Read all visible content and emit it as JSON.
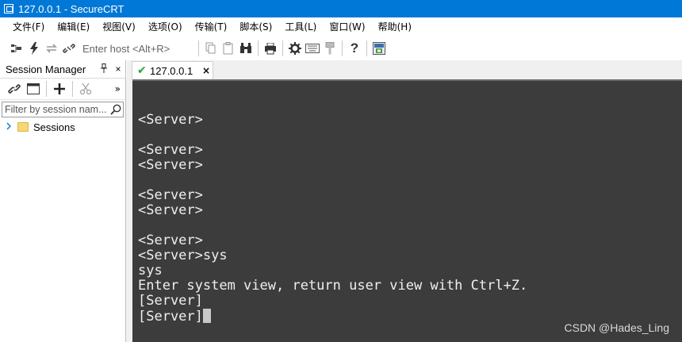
{
  "window": {
    "title": "127.0.0.1 - SecureCRT"
  },
  "menu": [
    "文件(F)",
    "编辑(E)",
    "视图(V)",
    "选项(O)",
    "传输(T)",
    "脚本(S)",
    "工具(L)",
    "窗口(W)",
    "帮助(H)"
  ],
  "toolbar": {
    "host_placeholder": "Enter host <Alt+R>"
  },
  "session_manager": {
    "title": "Session Manager",
    "pin_glyph": "ᵖ",
    "close_glyph": "×",
    "more_glyph": "»",
    "filter_placeholder": "Filter by session nam...",
    "tree": [
      {
        "label": "Sessions"
      }
    ]
  },
  "tab": {
    "label": "127.0.0.1",
    "close": "×"
  },
  "terminal": {
    "lines": [
      "<Server>",
      "",
      "<Server>",
      "<Server>",
      "",
      "<Server>",
      "<Server>",
      "",
      "<Server>",
      "<Server>sys",
      "sys",
      "Enter system view, return user view with Ctrl+Z.",
      "[Server]",
      "[Server]"
    ]
  },
  "watermark": "CSDN @Hades_Ling"
}
